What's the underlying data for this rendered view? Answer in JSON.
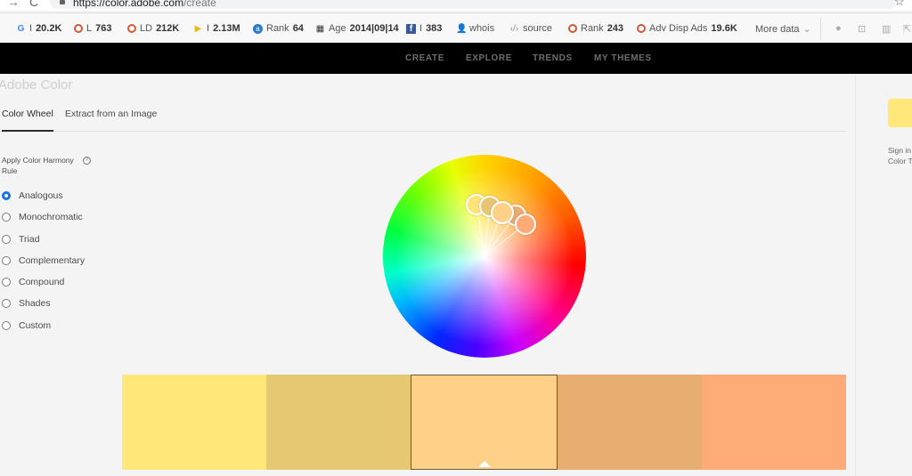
{
  "browser": {
    "url_host": "https://color.adobe.com",
    "url_path": "/create",
    "icons": [
      "back-arrow-icon",
      "reload-icon",
      "lock-icon",
      "star-icon"
    ]
  },
  "seo_toolbar": {
    "items": [
      {
        "icon": "google-icon",
        "prefix": "I",
        "value": "20.2K"
      },
      {
        "icon": "ring-icon",
        "prefix": "L",
        "value": "763"
      },
      {
        "icon": "ring-icon",
        "prefix": "LD",
        "value": "212K"
      },
      {
        "icon": "bing-icon",
        "prefix": "I",
        "value": "2.13M"
      },
      {
        "icon": "alexa-icon",
        "prefix": "Rank",
        "value": "64"
      },
      {
        "icon": "calendar-icon",
        "prefix": "Age",
        "value": "2014|09|14"
      },
      {
        "icon": "facebook-icon",
        "prefix": "I",
        "value": "383"
      },
      {
        "icon": "user-icon",
        "prefix": "whois",
        "value": ""
      },
      {
        "icon": "code-icon",
        "prefix": "source",
        "value": ""
      },
      {
        "icon": "ring-icon",
        "prefix": "Rank",
        "value": "243"
      },
      {
        "icon": "ring-icon",
        "prefix": "Adv Disp Ads",
        "value": "19.6K"
      }
    ],
    "more_data": "More data",
    "tools": [
      "info-icon",
      "presentation-icon",
      "chart-icon",
      "external-link-icon"
    ]
  },
  "topnav": {
    "items": [
      {
        "label": "CREATE",
        "active": true
      },
      {
        "label": "EXPLORE",
        "active": false
      },
      {
        "label": "TRENDS",
        "active": false
      },
      {
        "label": "MY THEMES",
        "active": false
      }
    ]
  },
  "brand": "Adobe Color",
  "tabs": [
    {
      "label": "Color Wheel",
      "active": true
    },
    {
      "label": "Extract from an Image",
      "active": false
    }
  ],
  "harmony": {
    "label": "Apply Color Harmony Rule",
    "help": "?",
    "selected": "Analogous",
    "options": [
      "Analogous",
      "Monochromatic",
      "Triad",
      "Complementary",
      "Compound",
      "Shades",
      "Custom"
    ]
  },
  "wheel": {
    "handles": [
      {
        "color": "#FFE27A"
      },
      {
        "color": "#E6C673"
      },
      {
        "color": "#FFD088",
        "base": true
      },
      {
        "color": "#E8AB72"
      },
      {
        "color": "#FFAB78"
      }
    ]
  },
  "swatches": [
    {
      "color": "#FFE77A",
      "selected": false
    },
    {
      "color": "#E6C873",
      "selected": false
    },
    {
      "color": "#FFD088",
      "selected": true
    },
    {
      "color": "#E8AD70",
      "selected": false
    },
    {
      "color": "#FFAB78",
      "selected": false
    }
  ],
  "right_panel": {
    "swatch_color": "#FFE77A",
    "text_line1": "Sign in to",
    "text_line2": "Color Themes"
  }
}
